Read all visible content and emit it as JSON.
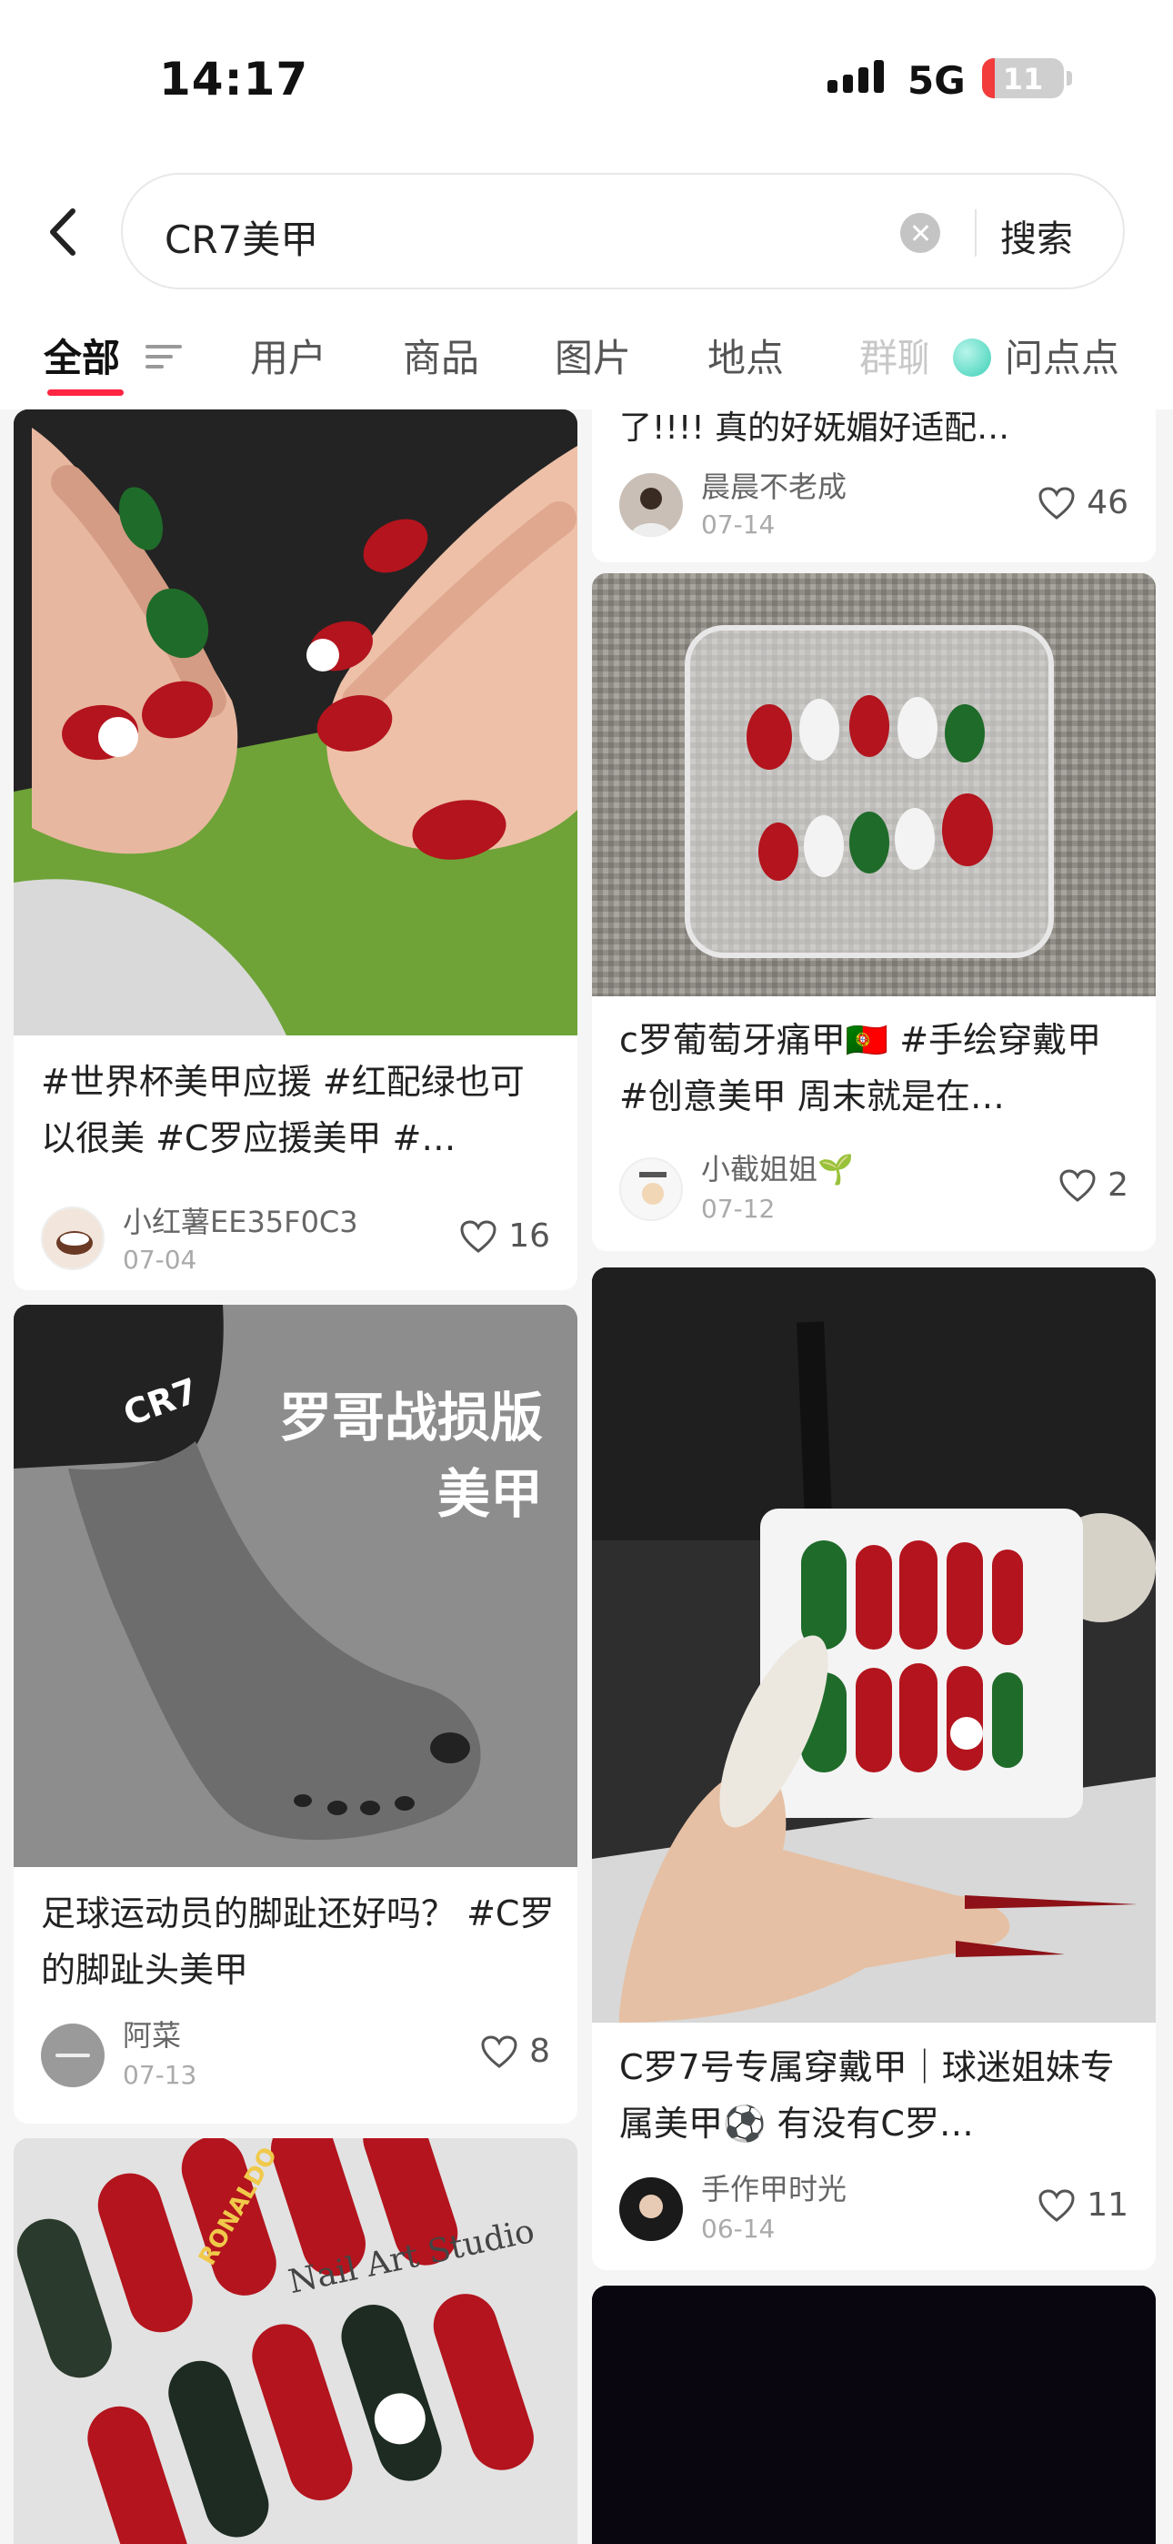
{
  "status_bar": {
    "time": "14:17",
    "network": "5G",
    "battery": "11"
  },
  "search": {
    "query": "CR7美甲",
    "submit_label": "搜索"
  },
  "tabs": [
    {
      "label": "全部"
    },
    {
      "label": "用户"
    },
    {
      "label": "商品"
    },
    {
      "label": "图片"
    },
    {
      "label": "地点"
    },
    {
      "label": "群聊"
    },
    {
      "label": "问点点"
    }
  ],
  "feed": {
    "left": [
      {
        "title": "#世界杯美甲应援 #红配绿也可以很美 #C罗应援美甲 #…",
        "author": "小红薯EE35F0C3",
        "date": "07-04",
        "likes": "16"
      },
      {
        "cover_text_line1": "罗哥战损版",
        "cover_text_line2": "美甲",
        "cover_sleeve_text": "CR7",
        "title": "足球运动员的脚趾还好吗？ #C罗的脚趾头美甲",
        "author": "阿菜",
        "date": "07-13",
        "likes": "8"
      },
      {
        "cover_text": "Nail Art Studio",
        "cover_nail_text": "RONALDO"
      }
    ],
    "right": [
      {
        "title": "了!!!! 真的好妩媚好适配…",
        "author": "晨晨不老成",
        "date": "07-14",
        "likes": "46"
      },
      {
        "title": "c罗葡萄牙痛甲🇵🇹 #手绘穿戴甲 #创意美甲 周末就是在…",
        "author": "小截姐姐🌱",
        "date": "07-12",
        "likes": "2"
      },
      {
        "title": "C罗7号专属穿戴甲｜球迷姐妹专属美甲⚽ 有没有C罗…",
        "author": "手作甲时光",
        "date": "06-14",
        "likes": "11"
      }
    ]
  },
  "colors": {
    "accent": "#ff2442",
    "nail_red": "#b3141d",
    "nail_green": "#1f6b2a"
  }
}
